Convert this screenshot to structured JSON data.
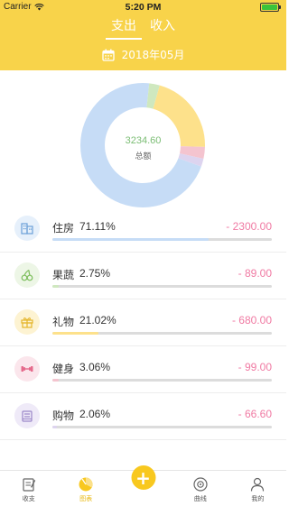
{
  "status_bar": {
    "carrier": "Carrier",
    "time": "5:20 PM"
  },
  "header": {
    "tabs": [
      {
        "label": "支出",
        "active": true
      },
      {
        "label": "收入",
        "active": false
      }
    ],
    "date": "2018年05月",
    "background": "#f8d34a"
  },
  "summary": {
    "total_value": "3234.60",
    "total_label": "总额"
  },
  "chart_data": {
    "type": "pie",
    "categories": [
      "住房",
      "果蔬",
      "礼物",
      "健身",
      "购物"
    ],
    "values": [
      71.11,
      2.75,
      21.02,
      3.06,
      2.06
    ],
    "colors": [
      "#c6dcf6",
      "#cfe8bf",
      "#fde18b",
      "#f4c4cf",
      "#ddd4ef"
    ]
  },
  "list": {
    "items": [
      {
        "name": "住房",
        "percent": "71.11%",
        "amount": "- 2300.00",
        "fraction": 0.7111,
        "color": "#c6dcf6",
        "icon": "building-icon"
      },
      {
        "name": "果蔬",
        "percent": "2.75%",
        "amount": "- 89.00",
        "fraction": 0.0275,
        "color": "#cfe8bf",
        "icon": "cherry-icon"
      },
      {
        "name": "礼物",
        "percent": "21.02%",
        "amount": "- 680.00",
        "fraction": 0.2102,
        "color": "#fde18b",
        "icon": "gift-icon"
      },
      {
        "name": "健身",
        "percent": "3.06%",
        "amount": "- 99.00",
        "fraction": 0.0306,
        "color": "#f4c4cf",
        "icon": "dumbbell-icon"
      },
      {
        "name": "购物",
        "percent": "2.06%",
        "amount": "- 66.60",
        "fraction": 0.0206,
        "color": "#ddd4ef",
        "icon": "shopping-icon"
      }
    ]
  },
  "tabbar": {
    "items": [
      {
        "label": "收支",
        "icon": "note-icon",
        "active": false
      },
      {
        "label": "图表",
        "icon": "chart-icon",
        "active": true
      },
      {
        "label": "",
        "icon": "plus-icon",
        "active": false
      },
      {
        "label": "曲线",
        "icon": "curve-icon",
        "active": false
      },
      {
        "label": "我的",
        "icon": "user-icon",
        "active": false
      }
    ]
  }
}
